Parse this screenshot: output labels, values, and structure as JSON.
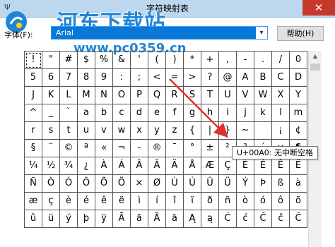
{
  "window": {
    "title": "字符映射表",
    "close_glyph": "✕",
    "app_glyph": "Ψ"
  },
  "watermark": {
    "name": "河东下载站",
    "url": "www.pc0359.cn"
  },
  "font_picker": {
    "label": "字体(F):",
    "value": "Arial",
    "arrow": "▾"
  },
  "help_button": {
    "label": "帮助(H)"
  },
  "tooltip": {
    "text": "U+00A0: 无中断空格"
  },
  "grid": {
    "rows": [
      [
        "!",
        "\"",
        "#",
        "$",
        "%",
        "&",
        "'",
        "(",
        ")",
        "*",
        "+",
        ",",
        "-",
        ".",
        "/",
        "0"
      ],
      [
        "5",
        "6",
        "7",
        "8",
        "9",
        ":",
        ";",
        "<",
        "=",
        ">",
        "?",
        "@",
        "A",
        "B",
        "C",
        "D"
      ],
      [
        "J",
        "K",
        "L",
        "M",
        "N",
        "O",
        "P",
        "Q",
        "R",
        "S",
        "T",
        "U",
        "V",
        "W",
        "X",
        "Y"
      ],
      [
        "^",
        "_",
        "`",
        "a",
        "b",
        "c",
        "d",
        "e",
        "f",
        "g",
        "h",
        "i",
        "j",
        "k",
        "l",
        "m"
      ],
      [
        "r",
        "s",
        "t",
        "u",
        "v",
        "w",
        "x",
        "y",
        "z",
        "{",
        "|",
        "}",
        "~",
        " ",
        "¡",
        "¢"
      ],
      [
        "§",
        "¨",
        "©",
        "ª",
        "«",
        "¬",
        "-",
        "®",
        "¯",
        "°",
        "±",
        "²",
        "³",
        "´",
        "µ",
        "¶"
      ],
      [
        "¼",
        "½",
        "¾",
        "¿",
        "À",
        "Á",
        "Â",
        "Ã",
        "Ä",
        "Å",
        "Æ",
        "Ç",
        "È",
        "É",
        "Ê",
        "Ë"
      ],
      [
        "Ñ",
        "Ò",
        "Ó",
        "Ô",
        "Õ",
        "Ö",
        "×",
        "Ø",
        "Ù",
        "Ú",
        "Û",
        "Ü",
        "Ý",
        "Þ",
        "ß",
        "à"
      ],
      [
        "æ",
        "ç",
        "è",
        "é",
        "ê",
        "ë",
        "ì",
        "í",
        "î",
        "ï",
        "ð",
        "ñ",
        "ò",
        "ó",
        "ô",
        "õ"
      ],
      [
        "û",
        "ü",
        "ý",
        "þ",
        "ÿ",
        "Ā",
        "ā",
        "Ă",
        "ă",
        "Ą",
        "ą",
        "Ć",
        "ć",
        "Ĉ",
        "ĉ",
        "Ċ"
      ]
    ]
  },
  "scrollbar": {
    "up_glyph": "▲"
  }
}
